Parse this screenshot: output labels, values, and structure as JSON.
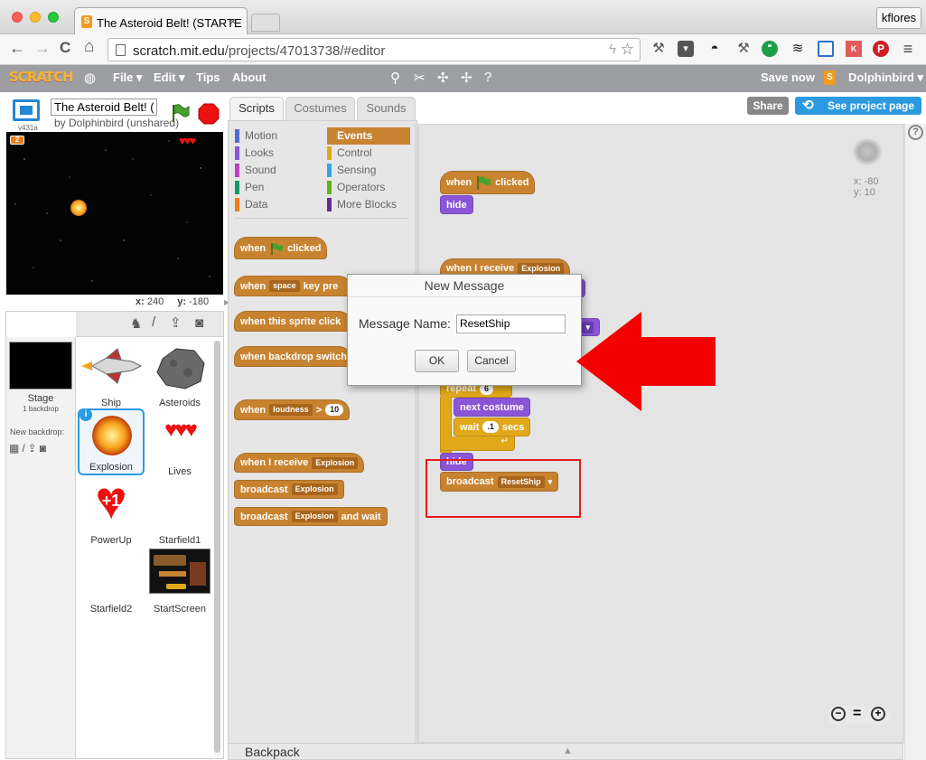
{
  "browser": {
    "tab_title": "The Asteroid Belt! (STARTE",
    "tab_close": "×",
    "profile": "kflores",
    "url_host": "scratch.mit.edu",
    "url_path": "/projects/47013738/#editor",
    "nav": {
      "back": "←",
      "forward": "→",
      "reload": "C",
      "home": "⌂"
    },
    "extensions": [
      "bolt-icon",
      "star-icon",
      "wrench-icon",
      "pocket-icon",
      "mask-icon",
      "wrench-icon",
      "hangouts-icon",
      "buffer-icon",
      "screen-icon",
      "kk-icon",
      "pinterest-icon",
      "menu-icon"
    ]
  },
  "menubar": {
    "logo": "SCRATCH",
    "file": "File ▾",
    "edit": "Edit ▾",
    "tips": "Tips",
    "about": "About",
    "save_now": "Save now",
    "user": "Dolphinbird ▾"
  },
  "project": {
    "title": "The Asteroid Belt! (",
    "byline": "by Dolphinbird (unshared)",
    "version": "v431a",
    "share": "Share",
    "see_project_page": "See project page"
  },
  "stage": {
    "score": "2",
    "x_label": "x:",
    "x_value": "240",
    "y_label": "y:",
    "y_value": "-180"
  },
  "sprites_panel": {
    "stage_label": "Stage",
    "backdrop_count": "1 backdrop",
    "new_backdrop": "New backdrop:",
    "sprites": [
      "Ship",
      "Asteroids",
      "Explosion",
      "Lives",
      "PowerUp",
      "Starfield1",
      "Starfield2",
      "StartScreen"
    ],
    "selected": "Explosion",
    "powerup_text": "+1"
  },
  "tabs": [
    "Scripts",
    "Costumes",
    "Sounds"
  ],
  "categories": {
    "left": [
      "Motion",
      "Looks",
      "Sound",
      "Pen",
      "Data"
    ],
    "right": [
      "Events",
      "Control",
      "Sensing",
      "Operators",
      "More Blocks"
    ],
    "active": "Events",
    "colors": {
      "Motion": "#4a6cd4",
      "Looks": "#8a55d7",
      "Sound": "#bb42c3",
      "Pen": "#0e9a6c",
      "Data": "#ee7d16",
      "Events": "#c88330",
      "Control": "#e1a91a",
      "Sensing": "#2ca5e2",
      "Operators": "#5cb712",
      "More Blocks": "#632d99"
    }
  },
  "palette_blocks": {
    "when": "when",
    "clicked": "clicked",
    "key_pressed": "key pre",
    "space": "space",
    "sprite_clicked": "when this sprite click",
    "backdrop_switches": "when backdrop switch",
    "loudness": "loudness",
    "gt": ">",
    "ten": "10",
    "when_i_receive": "when I receive",
    "explosion": "Explosion",
    "broadcast": "broadcast",
    "and_wait": "and wait"
  },
  "script_blocks": {
    "when": "when",
    "clicked": "clicked",
    "hide": "hide",
    "when_i_receive": "when I receive",
    "explosion": "Explosion",
    "repeat": "repeat",
    "repeat_count": "6",
    "next_costume": "next costume",
    "wait": "wait",
    "wait_value": ".1",
    "secs": "secs",
    "hide2": "hide",
    "broadcast": "broadcast",
    "reset_ship": "ResetShip"
  },
  "sprite_info": {
    "x": "x: -80",
    "y": "y: 10"
  },
  "zoom": {
    "out": "−",
    "reset": "=",
    "in": "+"
  },
  "dialog": {
    "title": "New Message",
    "label": "Message Name:",
    "value": "ResetShip",
    "ok": "OK",
    "cancel": "Cancel"
  },
  "backpack": "Backpack",
  "help": "?",
  "annotation_color": "#e21b1b"
}
